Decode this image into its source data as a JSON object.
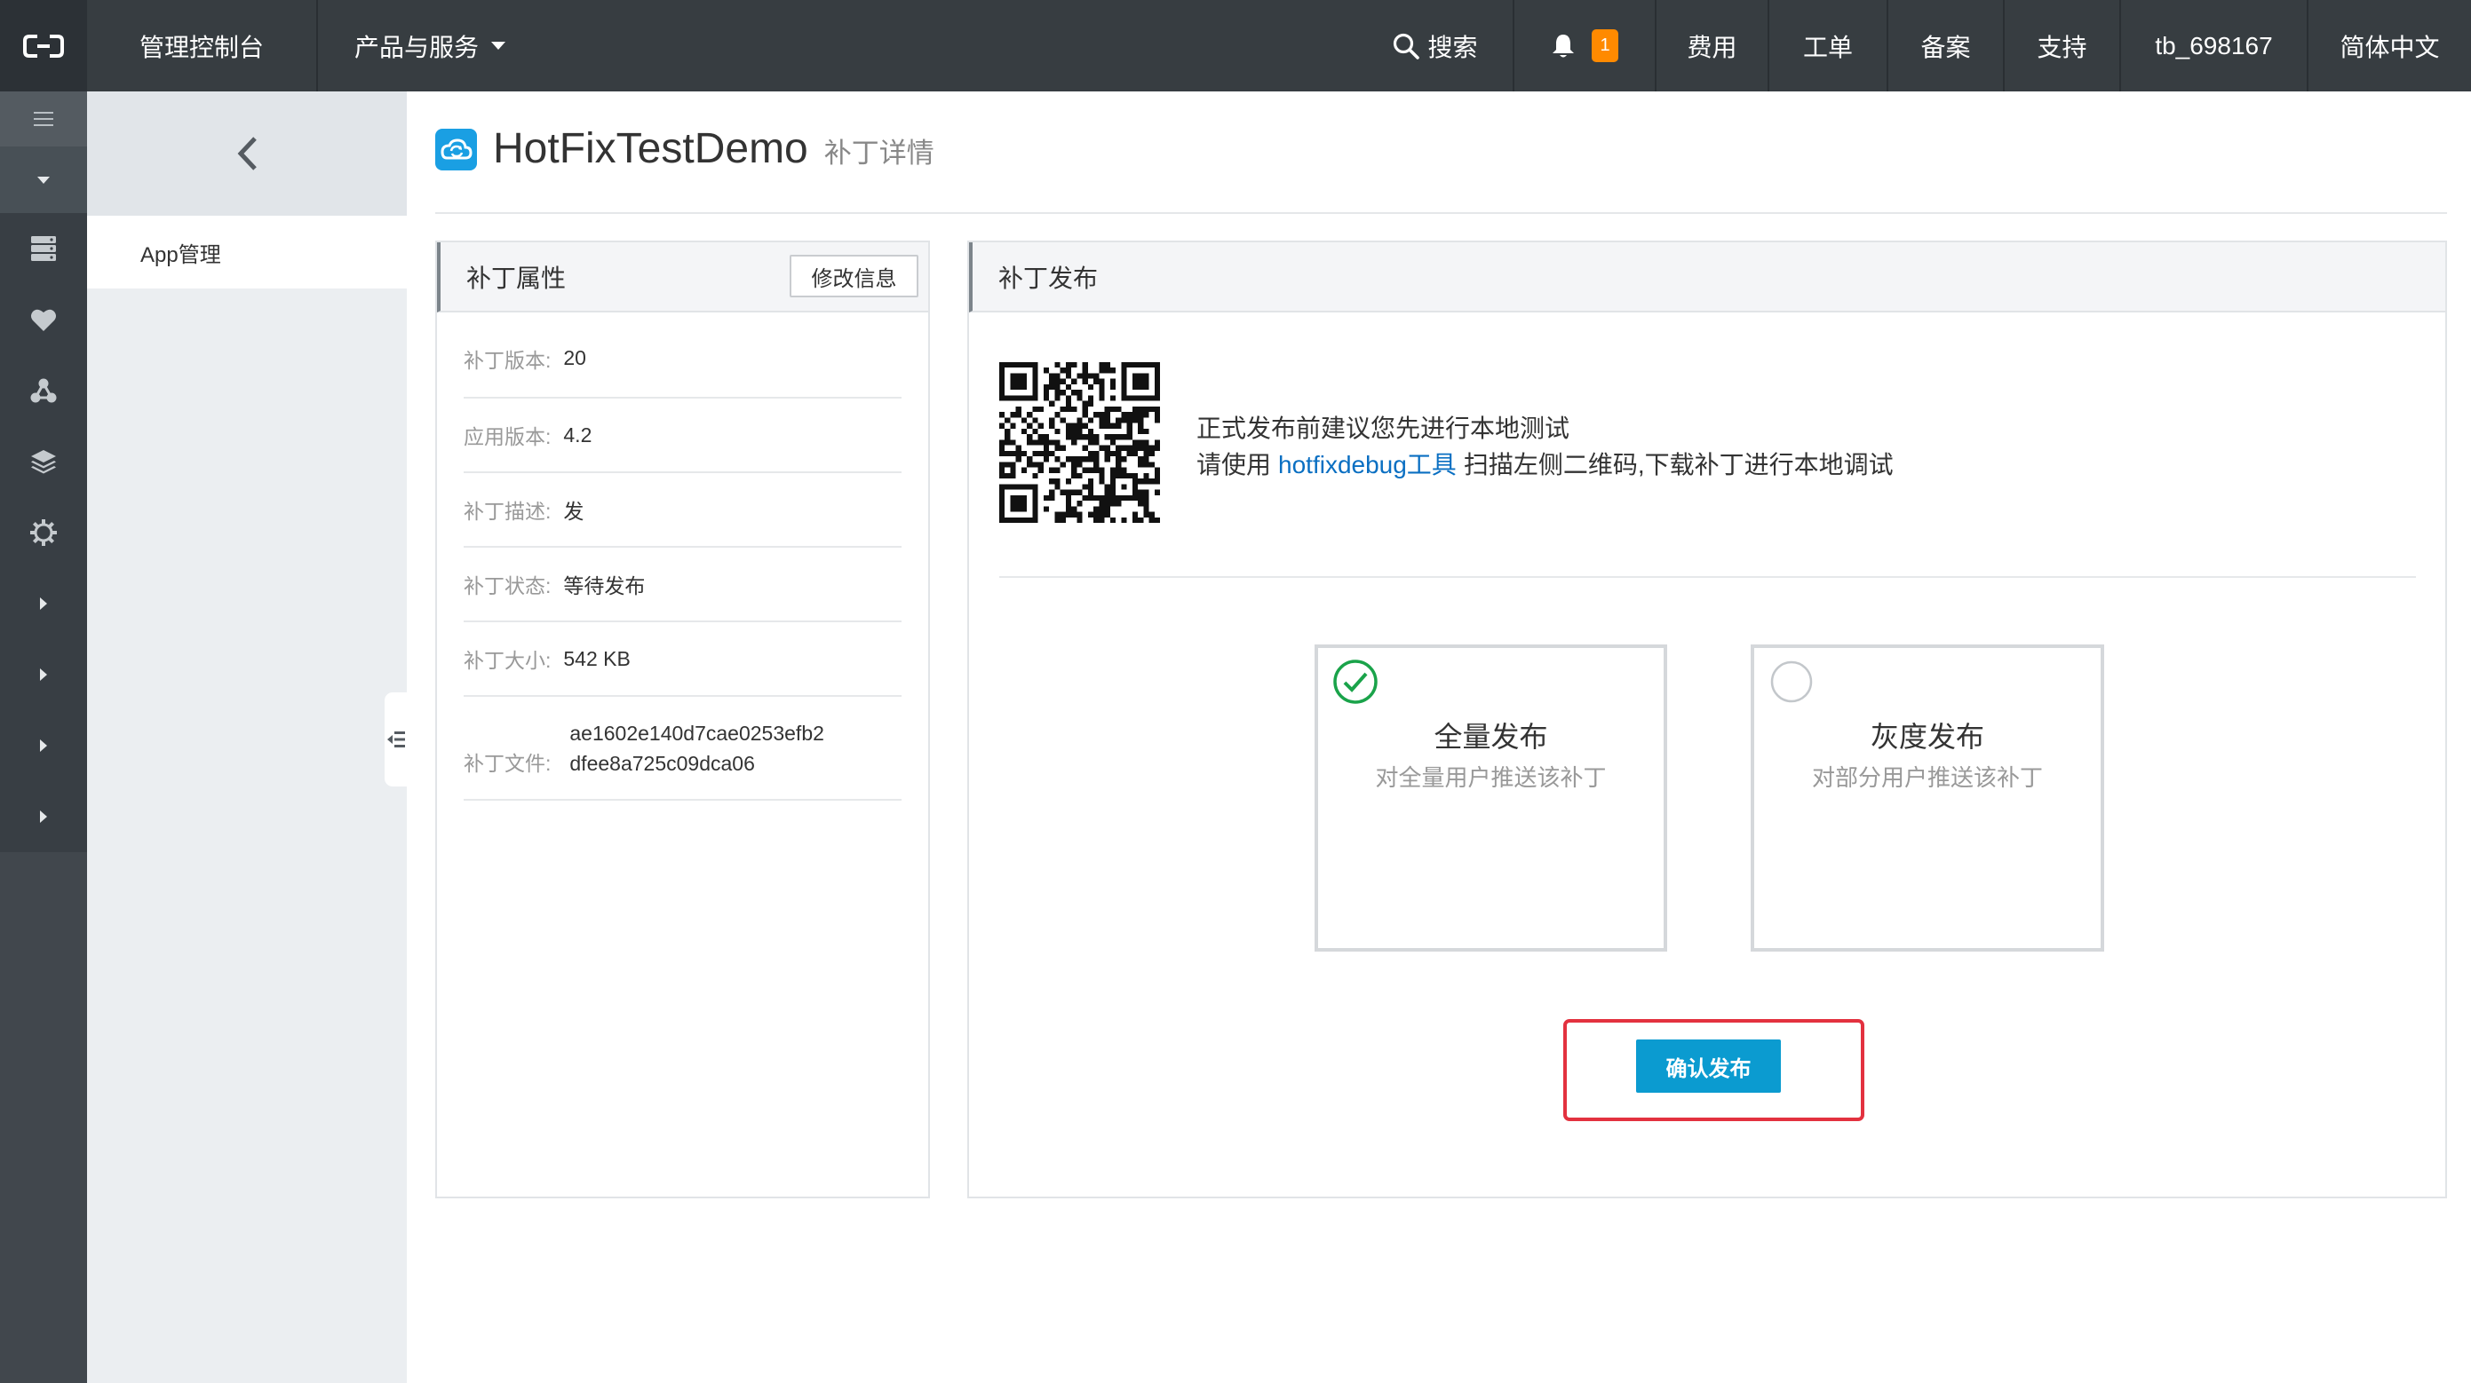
{
  "topbar": {
    "console_label": "管理控制台",
    "products_label": "产品与服务",
    "search_label": "搜索",
    "notification_count": "1",
    "billing_label": "费用",
    "tickets_label": "工单",
    "icp_label": "备案",
    "support_label": "支持",
    "username": "tb_698167",
    "language": "简体中文"
  },
  "sidebar": {
    "icons": [
      "menu-icon",
      "caret-down-icon",
      "server-icon",
      "heart-icon",
      "nodes-icon",
      "layers-icon",
      "gear-icon",
      "caret-right-icon",
      "caret-right-icon",
      "caret-right-icon",
      "caret-right-icon"
    ]
  },
  "subnav": {
    "items": [
      {
        "label": "App管理"
      }
    ]
  },
  "page": {
    "app_name": "HotFixTestDemo",
    "subtitle": "补丁详情"
  },
  "patch_props": {
    "title": "补丁属性",
    "edit_button": "修改信息",
    "rows": [
      {
        "label": "补丁版本:",
        "value": "20"
      },
      {
        "label": "应用版本:",
        "value": "4.2"
      },
      {
        "label": "补丁描述:",
        "value": "发"
      },
      {
        "label": "补丁状态:",
        "value": "等待发布"
      },
      {
        "label": "补丁大小:",
        "value": "542 KB"
      },
      {
        "label": "补丁文件:",
        "value_lines": [
          "ae1602e140d7cae0253efb2",
          "dfee8a725c09dca06"
        ]
      }
    ]
  },
  "publish": {
    "title": "补丁发布",
    "hint_line1": "正式发布前建议您先进行本地测试",
    "hint_prefix": "请使用",
    "tool_link": "hotfixdebug工具",
    "hint_suffix": "扫描左侧二维码,下载补丁进行本地调试",
    "options": [
      {
        "title": "全量发布",
        "desc": "对全量用户推送该补丁",
        "selected": true
      },
      {
        "title": "灰度发布",
        "desc": "对部分用户推送该补丁",
        "selected": false
      }
    ],
    "confirm_button": "确认发布"
  },
  "colors": {
    "topbar": "#373d41",
    "primary": "#0b9bd0",
    "success": "#1aa34a",
    "badge": "#ff8a00",
    "highlight": "#e3313f",
    "link": "#0a6fc2"
  }
}
